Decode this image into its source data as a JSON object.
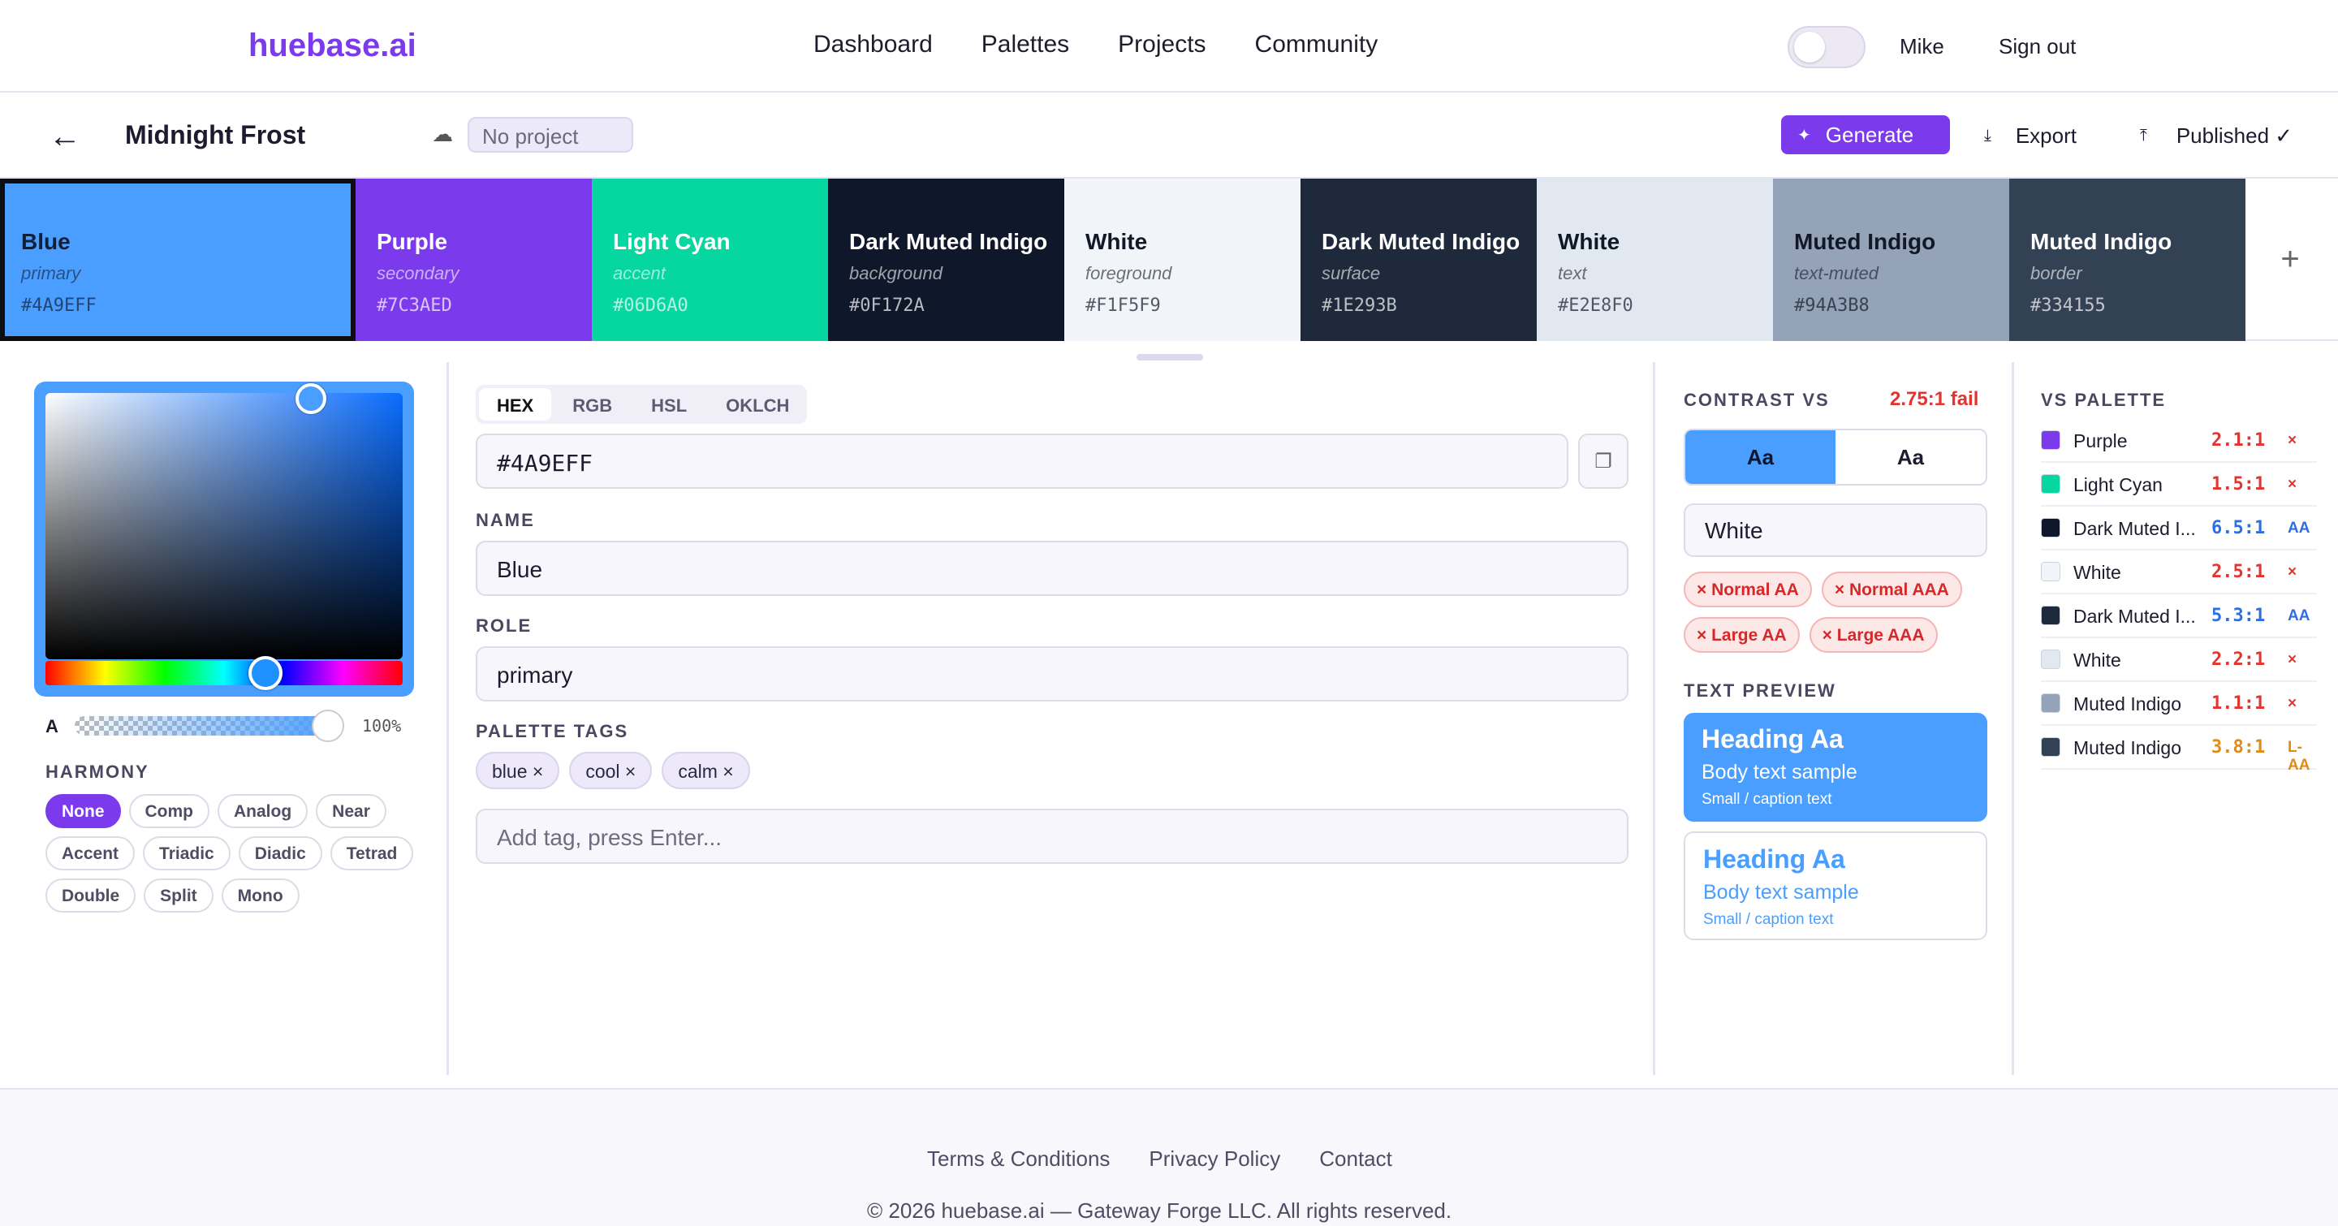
{
  "nav": {
    "logo": "huebase.ai",
    "links": [
      "Dashboard",
      "Palettes",
      "Projects",
      "Community"
    ],
    "user": "Mike",
    "sign_out": "Sign out"
  },
  "toolbar": {
    "back_icon": "←",
    "palette_name": "Midnight Frost",
    "project": "No project",
    "generate": "Generate",
    "export": "Export",
    "published": "Published ✓"
  },
  "swatches": [
    {
      "name": "Blue",
      "role": "primary",
      "hex": "#4A9EFF",
      "color": "#4A9EFF",
      "text": "#10203a"
    },
    {
      "name": "Purple",
      "role": "secondary",
      "hex": "#7C3AED",
      "color": "#7C3AED",
      "text": "#ffffff"
    },
    {
      "name": "Light Cyan",
      "role": "accent",
      "hex": "#06D6A0",
      "color": "#06D6A0",
      "text": "#ffffff"
    },
    {
      "name": "Dark Muted Indigo",
      "role": "background",
      "hex": "#0F172A",
      "color": "#0F172A",
      "text": "#ffffff"
    },
    {
      "name": "White",
      "role": "foreground",
      "hex": "#F1F5F9",
      "color": "#F1F5F9",
      "text": "#111827"
    },
    {
      "name": "Dark Muted Indigo",
      "role": "surface",
      "hex": "#1E293B",
      "color": "#1E293B",
      "text": "#ffffff"
    },
    {
      "name": "White",
      "role": "text",
      "hex": "#E2E8F0",
      "color": "#E2E8F0",
      "text": "#111827"
    },
    {
      "name": "Muted Indigo",
      "role": "text-muted",
      "hex": "#94A3B8",
      "color": "#94A3B8",
      "text": "#111827"
    },
    {
      "name": "Muted Indigo",
      "role": "border",
      "hex": "#334155",
      "color": "#334155",
      "text": "#ffffff"
    }
  ],
  "add_swatch": "+",
  "picker": {
    "alpha_label": "A",
    "alpha": "100%",
    "harmony_label": "HARMONY",
    "harmony": [
      "None",
      "Comp",
      "Analog",
      "Near",
      "Accent",
      "Triadic",
      "Diadic",
      "Tetrad",
      "Double",
      "Split",
      "Mono"
    ]
  },
  "editor": {
    "formats": [
      "HEX",
      "RGB",
      "HSL",
      "OKLCH"
    ],
    "hex_value": "#4A9EFF",
    "name_label": "NAME",
    "name_value": "Blue",
    "role_label": "ROLE",
    "role_value": "primary",
    "tags_label": "PALETTE TAGS",
    "tags": [
      "blue ×",
      "cool ×",
      "calm ×"
    ],
    "tag_placeholder": "Add tag, press Enter..."
  },
  "contrast": {
    "label": "CONTRAST VS",
    "ratio": "2.75:1 fail",
    "seg_a": "Aa",
    "seg_b": "Aa",
    "against": "White",
    "badges": [
      "× Normal AA",
      "× Normal AAA",
      "× Large AA",
      "× Large AAA"
    ],
    "preview_label": "TEXT PREVIEW",
    "heading": "Heading Aa",
    "body": "Body text sample",
    "small": "Small / caption text"
  },
  "vs_palette": {
    "label": "VS PALETTE",
    "rows": [
      {
        "name": "Purple",
        "color": "#7C3AED",
        "ratio": "2.1:1",
        "result": "×",
        "cls": "fail"
      },
      {
        "name": "Light Cyan",
        "color": "#06D6A0",
        "ratio": "1.5:1",
        "result": "×",
        "cls": "fail"
      },
      {
        "name": "Dark Muted I...",
        "color": "#0F172A",
        "ratio": "6.5:1",
        "result": "AA",
        "cls": "aa"
      },
      {
        "name": "White",
        "color": "#F1F5F9",
        "ratio": "2.5:1",
        "result": "×",
        "cls": "fail"
      },
      {
        "name": "Dark Muted I...",
        "color": "#1E293B",
        "ratio": "5.3:1",
        "result": "AA",
        "cls": "aa"
      },
      {
        "name": "White",
        "color": "#E2E8F0",
        "ratio": "2.2:1",
        "result": "×",
        "cls": "fail"
      },
      {
        "name": "Muted Indigo",
        "color": "#94A3B8",
        "ratio": "1.1:1",
        "result": "×",
        "cls": "fail"
      },
      {
        "name": "Muted Indigo",
        "color": "#334155",
        "ratio": "3.8:1",
        "result": "L-AA",
        "cls": "laa"
      }
    ]
  },
  "footer": {
    "links": [
      "Terms & Conditions",
      "Privacy Policy",
      "Contact"
    ],
    "copyright": "© 2026 huebase.ai — Gateway Forge LLC. All rights reserved."
  },
  "colors": {
    "brand": "#7c3aed",
    "primary": "#4a9eff",
    "fail": "#e3342f"
  }
}
